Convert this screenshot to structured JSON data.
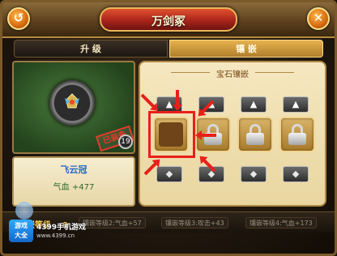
{
  "window": {
    "title": "万剑冢"
  },
  "header": {
    "back_label": "↺",
    "close_label": "✕"
  },
  "tabs": [
    {
      "label": "升  级",
      "active": false
    },
    {
      "label": "镶  嵌",
      "active": true
    }
  ],
  "item": {
    "name": "飞云冠",
    "stat": "气血 +477",
    "seal": "已装备",
    "level_badge": "19"
  },
  "inlay_panel": {
    "section_title": "宝石镶嵌",
    "up_arrow": "▲",
    "gem_glyph": "◆",
    "slots": [
      {
        "state": "open"
      },
      {
        "state": "locked"
      },
      {
        "state": "locked"
      },
      {
        "state": "locked"
      }
    ]
  },
  "bottom": {
    "inlay_level_label": "镶嵌等级",
    "inlay_level_value": "0",
    "bonuses": [
      "镶嵌等级2:气血+57",
      "镶嵌等级3:攻击+43",
      "镶嵌等级4:气血+173"
    ]
  },
  "watermark": {
    "logo": "游戏\n大全",
    "text": "4399手机游戏",
    "url": "www.4399.cn"
  },
  "colors": {
    "accent_red": "#e8201a",
    "tab_active": "#e6b24e",
    "item_name": "#2a6ac8"
  }
}
